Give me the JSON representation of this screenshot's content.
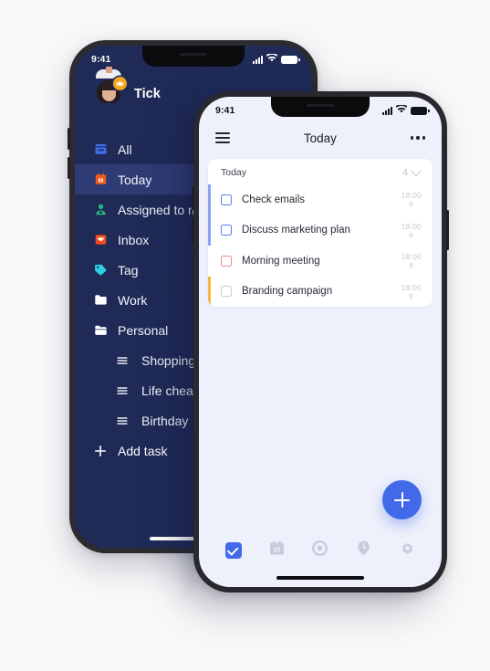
{
  "back_phone": {
    "status_bar": {
      "time": "9:41",
      "signal_icon": "signal-bars-icon",
      "wifi_icon": "wifi-icon",
      "battery_icon": "battery-icon"
    },
    "user": {
      "name": "Tick",
      "avatar_icon": "avatar-photo",
      "badge_icon": "crown-badge-icon"
    },
    "nav_items": [
      {
        "label": "All",
        "icon": "stack-icon",
        "color": "#3f6fe8",
        "active": false,
        "sub": false
      },
      {
        "label": "Today",
        "icon": "calendar-icon",
        "color": "#ee5c1c",
        "active": true,
        "sub": false
      },
      {
        "label": "Assigned to me",
        "icon": "person-icon",
        "color": "#27b47a",
        "active": false,
        "sub": false
      },
      {
        "label": "Inbox",
        "icon": "inbox-tray-icon",
        "color": "#ee4d1c",
        "active": false,
        "sub": false
      },
      {
        "label": "Tag",
        "icon": "tag-icon",
        "color": "#2fd0e0",
        "active": false,
        "sub": false
      },
      {
        "label": "Work",
        "icon": "folder-icon",
        "color": "#ffffff",
        "active": false,
        "sub": false
      },
      {
        "label": "Personal",
        "icon": "folder-open-icon",
        "color": "#ffffff",
        "active": false,
        "sub": false
      },
      {
        "label": "Shopping",
        "icon": "list-lines-icon",
        "color": "#ffffff",
        "active": false,
        "sub": true
      },
      {
        "label": "Life cheat sheet",
        "icon": "list-lines-icon",
        "color": "#ffffff",
        "active": false,
        "sub": true
      },
      {
        "label": "Birthday",
        "icon": "list-lines-icon",
        "color": "#ffffff",
        "active": false,
        "sub": true
      }
    ],
    "add_task": {
      "label": "Add task",
      "icon": "plus-icon"
    },
    "colors": {
      "screen_bg": "#1f2a57",
      "active_row": "#2f3b75"
    }
  },
  "front_phone": {
    "status_bar": {
      "time": "9:41",
      "signal_icon": "signal-bars-icon",
      "wifi_icon": "wifi-icon",
      "battery_icon": "battery-icon"
    },
    "header": {
      "menu_icon": "hamburger-menu-icon",
      "title": "Today",
      "more_icon": "more-options-icon"
    },
    "list_card": {
      "section_title": "Today",
      "count": "4",
      "collapse_icon": "chevron-down-icon",
      "tasks": [
        {
          "title": "Check emails",
          "time": "18:00",
          "bell_icon": "bell-icon",
          "checkbox_color": "#5b7cf5",
          "accent": "#8aa4f2",
          "has_accent": true
        },
        {
          "title": "Discuss marketing plan",
          "time": "18:00",
          "bell_icon": "bell-icon",
          "checkbox_color": "#5b7cf5",
          "accent": "#8aa4f2",
          "has_accent": true
        },
        {
          "title": "Morning meeting",
          "time": "18:00",
          "bell_icon": "bell-icon",
          "checkbox_color": "#f08a8a",
          "accent": "#ffffff",
          "has_accent": false
        },
        {
          "title": "Branding campaign",
          "time": "18:00",
          "bell_icon": "bell-icon",
          "checkbox_color": "#c9ccd6",
          "accent": "#f5b942",
          "has_accent": true
        }
      ]
    },
    "fab": {
      "icon": "plus-icon",
      "color": "#4169e8"
    },
    "tab_bar": {
      "tabs": [
        {
          "name": "tasks",
          "icon": "checkbox-checked-icon",
          "active": true
        },
        {
          "name": "calendar",
          "icon": "calendar-20-icon",
          "active": false
        },
        {
          "name": "focus",
          "icon": "target-icon",
          "active": false
        },
        {
          "name": "pin",
          "icon": "pin-clock-icon",
          "active": false
        },
        {
          "name": "settings",
          "icon": "gear-icon",
          "active": false
        }
      ]
    },
    "colors": {
      "screen_bg": "#eef0fb",
      "card_bg": "#ffffff",
      "accent": "#4169e8"
    }
  },
  "page": {
    "background": "#f8f8f9"
  }
}
